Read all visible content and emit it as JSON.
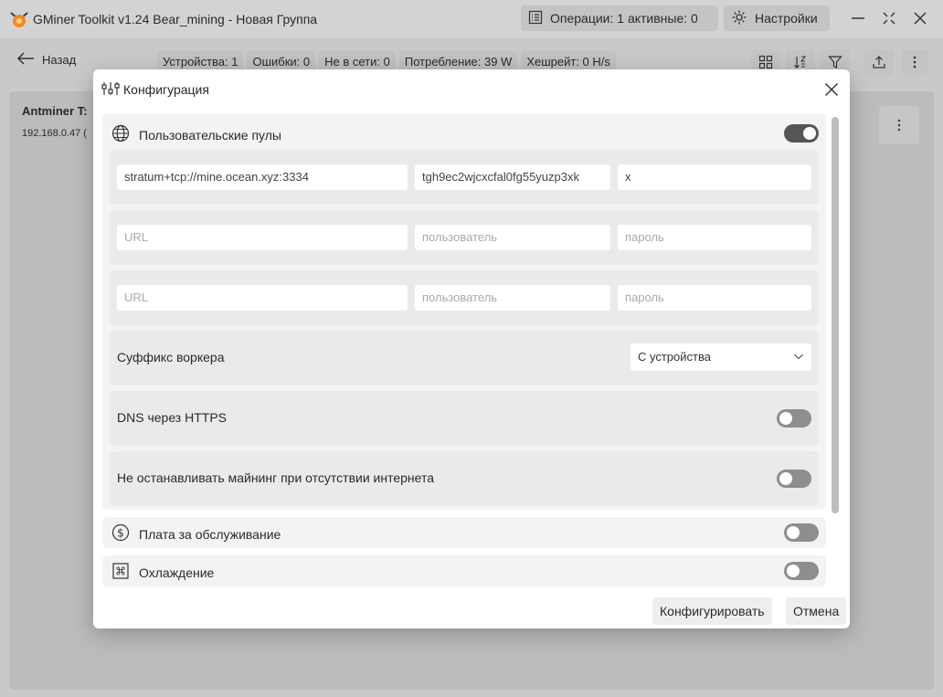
{
  "app": {
    "title": "GMiner Toolkit v1.24 Bear_mining - Новая Группа",
    "operations_label": "Операции: 1 активные: 0",
    "settings_label": "Настройки"
  },
  "toolbar": {
    "back_label": "Назад",
    "stats": [
      "Устройства: 1",
      "Ошибки: 0",
      "Не в сети: 0",
      "Потребление: 39 W",
      "Хешрейт: 0 H/s"
    ]
  },
  "device": {
    "name": "Antminer T:",
    "ip": "192.168.0.47 ("
  },
  "modal": {
    "title": "Конфигурация",
    "pools": {
      "label": "Пользовательские пулы",
      "enabled": true,
      "rows": [
        {
          "url": "stratum+tcp://mine.ocean.xyz:3334",
          "user": "tgh9ec2wjcxcfal0fg55yuzp3xk",
          "password": "x"
        },
        {
          "url": "",
          "user": "",
          "password": ""
        },
        {
          "url": "",
          "user": "",
          "password": ""
        }
      ],
      "placeholders": {
        "url": "URL",
        "user": "пользователь",
        "password": "пароль"
      }
    },
    "worker_suffix": {
      "label": "Суффикс воркера",
      "value": "С устройства"
    },
    "dns_https": {
      "label": "DNS через HTTPS",
      "enabled": false
    },
    "keep_mining": {
      "label": "Не останавливать майнинг при отсутствии интернета",
      "enabled": false
    },
    "fee": {
      "label": "Плата за обслуживание",
      "enabled": false
    },
    "cooling": {
      "label": "Охлаждение",
      "enabled": false
    },
    "configure_label": "Конфигурировать",
    "cancel_label": "Отмена"
  },
  "colors": {
    "backdrop": "#c9c9c9",
    "toggle_on": "#555555",
    "toggle_off": "#8e8e8e",
    "logo_orange": "#f08a24"
  }
}
